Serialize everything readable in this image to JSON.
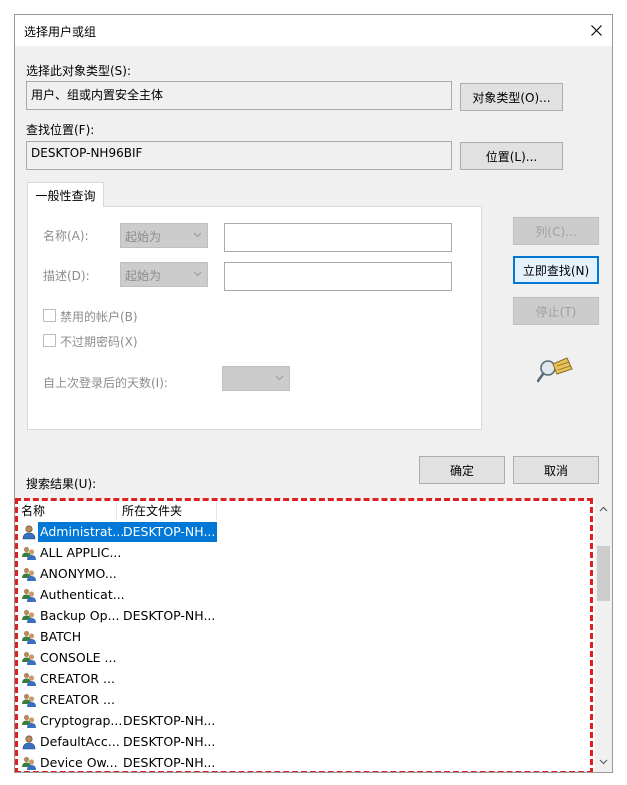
{
  "window": {
    "title": "选择用户或组"
  },
  "object_type": {
    "label": "选择此对象类型(S):",
    "value": "用户、组或内置安全主体",
    "button": "对象类型(O)..."
  },
  "location": {
    "label": "查找位置(F):",
    "value": "DESKTOP-NH96BIF",
    "button": "位置(L)..."
  },
  "query": {
    "tab": "一般性查询",
    "name_label": "名称(A):",
    "name_combo": "起始为",
    "desc_label": "描述(D):",
    "desc_combo": "起始为",
    "disabled_accounts": "禁用的帐户(B)",
    "non_expiring": "不过期密码(X)",
    "days_label": "自上次登录后的天数(I):"
  },
  "side_buttons": {
    "columns": "列(C)...",
    "find_now": "立即查找(N)",
    "stop": "停止(T)"
  },
  "results_label": "搜索结果(U):",
  "ok": "确定",
  "cancel": "取消",
  "results": {
    "columns": [
      "名称",
      "所在文件夹"
    ],
    "rows": [
      {
        "name": "Administrat...",
        "folder": "DESKTOP-NH...",
        "icon": "user-icon"
      },
      {
        "name": "ALL APPLIC...",
        "folder": "",
        "icon": "group-icon"
      },
      {
        "name": "ANONYMO...",
        "folder": "",
        "icon": "group-icon"
      },
      {
        "name": "Authenticat...",
        "folder": "",
        "icon": "group-icon"
      },
      {
        "name": "Backup Op...",
        "folder": "DESKTOP-NH...",
        "icon": "group-icon"
      },
      {
        "name": "BATCH",
        "folder": "",
        "icon": "group-icon"
      },
      {
        "name": "CONSOLE ...",
        "folder": "",
        "icon": "group-icon"
      },
      {
        "name": "CREATOR ...",
        "folder": "",
        "icon": "group-icon"
      },
      {
        "name": "CREATOR ...",
        "folder": "",
        "icon": "group-icon"
      },
      {
        "name": "Cryptograp...",
        "folder": "DESKTOP-NH...",
        "icon": "group-icon"
      },
      {
        "name": "DefaultAcc...",
        "folder": "DESKTOP-NH...",
        "icon": "user-icon"
      },
      {
        "name": "Device Ow...",
        "folder": "DESKTOP-NH...",
        "icon": "group-icon"
      }
    ]
  },
  "colors": {
    "accent": "#0078d7",
    "highlight_border": "#e02020"
  }
}
